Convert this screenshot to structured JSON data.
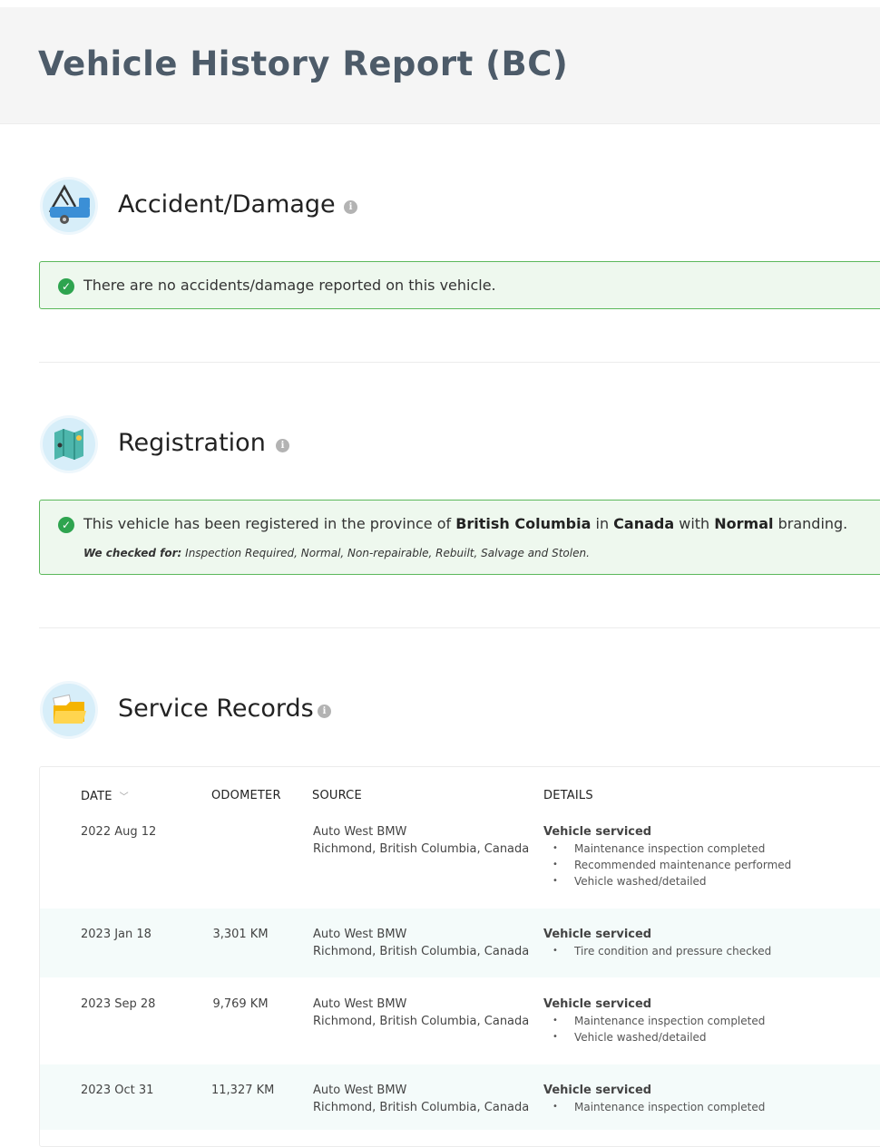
{
  "page": {
    "title": "Vehicle History Report (BC)"
  },
  "sections": {
    "accident": {
      "title": "Accident/Damage",
      "icon": "tow-truck-icon",
      "message": "There are no accidents/damage reported on this vehicle."
    },
    "registration": {
      "title": "Registration",
      "icon": "map-icon",
      "message_pre": "This vehicle has been registered in the province of ",
      "province": "British Columbia",
      "message_mid1": " in ",
      "country": "Canada",
      "message_mid2": " with ",
      "branding": "Normal",
      "message_post": " branding.",
      "note_label": "We checked for:",
      "note_text": " Inspection Required, Normal, Non-repairable, Rebuilt, Salvage and Stolen."
    },
    "service": {
      "title": "Service Records",
      "icon": "folder-icon",
      "columns": {
        "date": "DATE",
        "odometer": "ODOMETER",
        "source": "SOURCE",
        "details": "DETAILS"
      },
      "sort_icon": "chevron-down-icon",
      "rows": [
        {
          "date": "2022 Aug 12",
          "odometer": "",
          "source_name": "Auto West BMW",
          "source_location": "Richmond, British Columbia, Canada",
          "detail_title": "Vehicle serviced",
          "items": [
            "Maintenance inspection completed",
            "Recommended maintenance performed",
            "Vehicle washed/detailed"
          ]
        },
        {
          "date": "2023 Jan 18",
          "odometer": "3,301 KM",
          "source_name": "Auto West BMW",
          "source_location": "Richmond, British Columbia, Canada",
          "detail_title": "Vehicle serviced",
          "items": [
            "Tire condition and pressure checked"
          ]
        },
        {
          "date": "2023 Sep 28",
          "odometer": "9,769 KM",
          "source_name": "Auto West BMW",
          "source_location": "Richmond, British Columbia, Canada",
          "detail_title": "Vehicle serviced",
          "items": [
            "Maintenance inspection completed",
            "Vehicle washed/detailed"
          ]
        },
        {
          "date": "2023 Oct 31",
          "odometer": "11,327 KM",
          "source_name": "Auto West BMW",
          "source_location": "Richmond, British Columbia, Canada",
          "detail_title": "Vehicle serviced",
          "items": [
            "Maintenance inspection completed"
          ]
        }
      ]
    }
  },
  "colors": {
    "success": "#2ea44f",
    "alert_bg": "#eef8ee",
    "title": "#4d5b69",
    "row_alt": "#f4fbfa"
  }
}
